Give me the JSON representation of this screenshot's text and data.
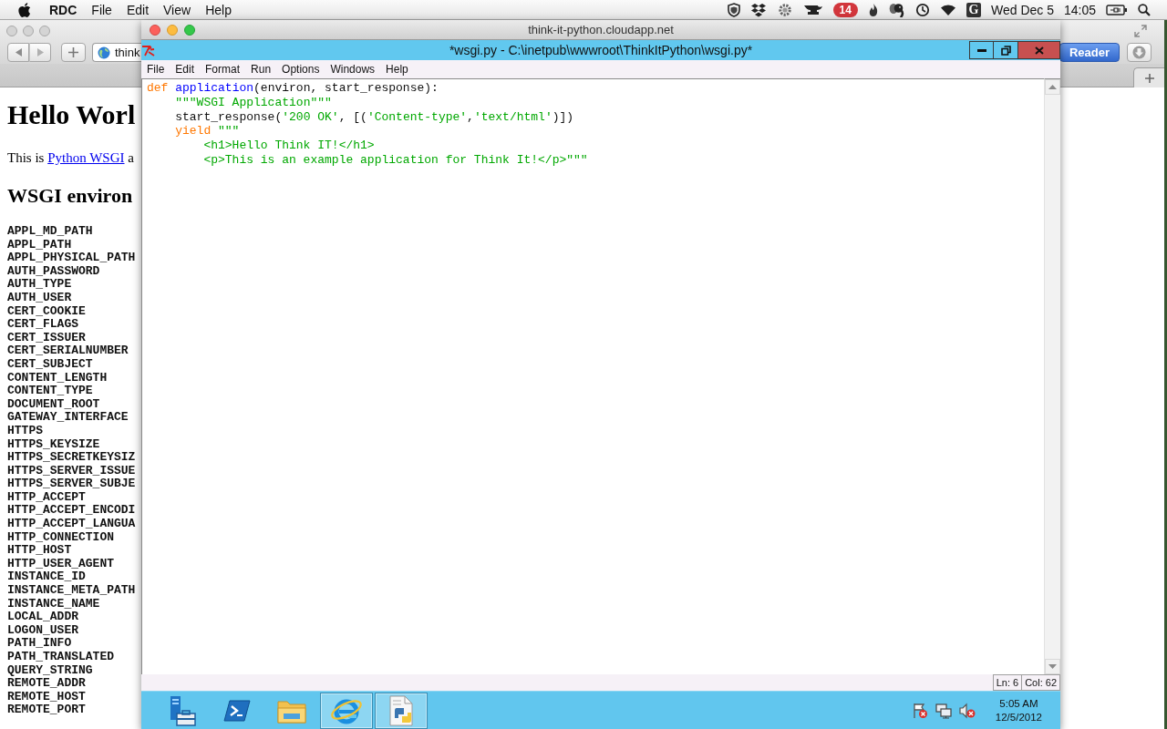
{
  "menu_bar": {
    "app_name": "RDC",
    "menus": [
      "File",
      "Edit",
      "View",
      "Help"
    ],
    "notification_count": "14",
    "letter_tile": "G",
    "date": "Wed Dec 5",
    "time": "14:05"
  },
  "browser": {
    "address": "think",
    "reader_button": "Reader",
    "page": {
      "heading": "Hello Worl",
      "intro": {
        "before": "This is ",
        "link": "Python WSGI",
        "after": " a"
      },
      "section_heading": "WSGI environ",
      "environ": [
        "APPL_MD_PATH",
        "APPL_PATH",
        "APPL_PHYSICAL_PATH",
        "AUTH_PASSWORD",
        "AUTH_TYPE",
        "AUTH_USER",
        "CERT_COOKIE",
        "CERT_FLAGS",
        "CERT_ISSUER",
        "CERT_SERIALNUMBER",
        "CERT_SUBJECT",
        "CONTENT_LENGTH",
        "CONTENT_TYPE",
        "DOCUMENT_ROOT",
        "GATEWAY_INTERFACE",
        "HTTPS",
        "HTTPS_KEYSIZE",
        "HTTPS_SECRETKEYSIZ",
        "HTTPS_SERVER_ISSUE",
        "HTTPS_SERVER_SUBJE",
        "HTTP_ACCEPT",
        "HTTP_ACCEPT_ENCODI",
        "HTTP_ACCEPT_LANGUA",
        "HTTP_CONNECTION",
        "HTTP_HOST",
        "HTTP_USER_AGENT",
        "INSTANCE_ID",
        "INSTANCE_META_PATH",
        "INSTANCE_NAME",
        "LOCAL_ADDR",
        "LOGON_USER",
        "PATH_INFO",
        "PATH_TRANSLATED",
        "QUERY_STRING",
        "REMOTE_ADDR",
        "REMOTE_HOST",
        "REMOTE_PORT"
      ]
    }
  },
  "remote_window": {
    "title": "think-it-python.cloudapp.net",
    "editor": {
      "title": "*wsgi.py - C:\\inetpub\\wwwroot\\ThinkItPython\\wsgi.py*",
      "menus": [
        "File",
        "Edit",
        "Format",
        "Run",
        "Options",
        "Windows",
        "Help"
      ],
      "code": [
        {
          "tokens": [
            {
              "kind": "keyword",
              "text": "def "
            },
            {
              "kind": "function",
              "text": "application"
            },
            {
              "kind": "plain",
              "text": "(environ, start_response):"
            }
          ],
          "children": [
            {
              "tokens": [
                {
                  "kind": "string",
                  "text": "\"\"\"WSGI Application\"\"\""
                }
              ]
            },
            {
              "tokens": [
                {
                  "kind": "plain",
                  "text": "start_response("
                },
                {
                  "kind": "string",
                  "text": "'200 OK'"
                },
                {
                  "kind": "plain",
                  "text": ", [("
                },
                {
                  "kind": "string",
                  "text": "'Content-type'"
                },
                {
                  "kind": "plain",
                  "text": ","
                },
                {
                  "kind": "string",
                  "text": "'text/html'"
                },
                {
                  "kind": "plain",
                  "text": ")])"
                }
              ]
            },
            {
              "tokens": [
                {
                  "kind": "keyword",
                  "text": "yield "
                },
                {
                  "kind": "string",
                  "text": "\"\"\""
                }
              ],
              "children": [
                {
                  "tokens": [
                    {
                      "kind": "string",
                      "text": "<h1>Hello Think IT!</h1>"
                    }
                  ]
                },
                {
                  "tokens": [
                    {
                      "kind": "string",
                      "text": "<p>This is an example application for Think It!</p>\"\"\""
                    }
                  ]
                }
              ]
            }
          ]
        }
      ],
      "status": {
        "line": "Ln: 6",
        "column": "Col: 62"
      }
    },
    "taskbar": {
      "apps": [
        {
          "kind": "server-manager",
          "running": false
        },
        {
          "kind": "powershell",
          "running": false
        },
        {
          "kind": "explorer",
          "running": false
        },
        {
          "kind": "browser",
          "running": true
        },
        {
          "kind": "python",
          "running": true
        }
      ],
      "clock": {
        "time": "5:05 AM",
        "date": "12/5/2012"
      }
    }
  }
}
